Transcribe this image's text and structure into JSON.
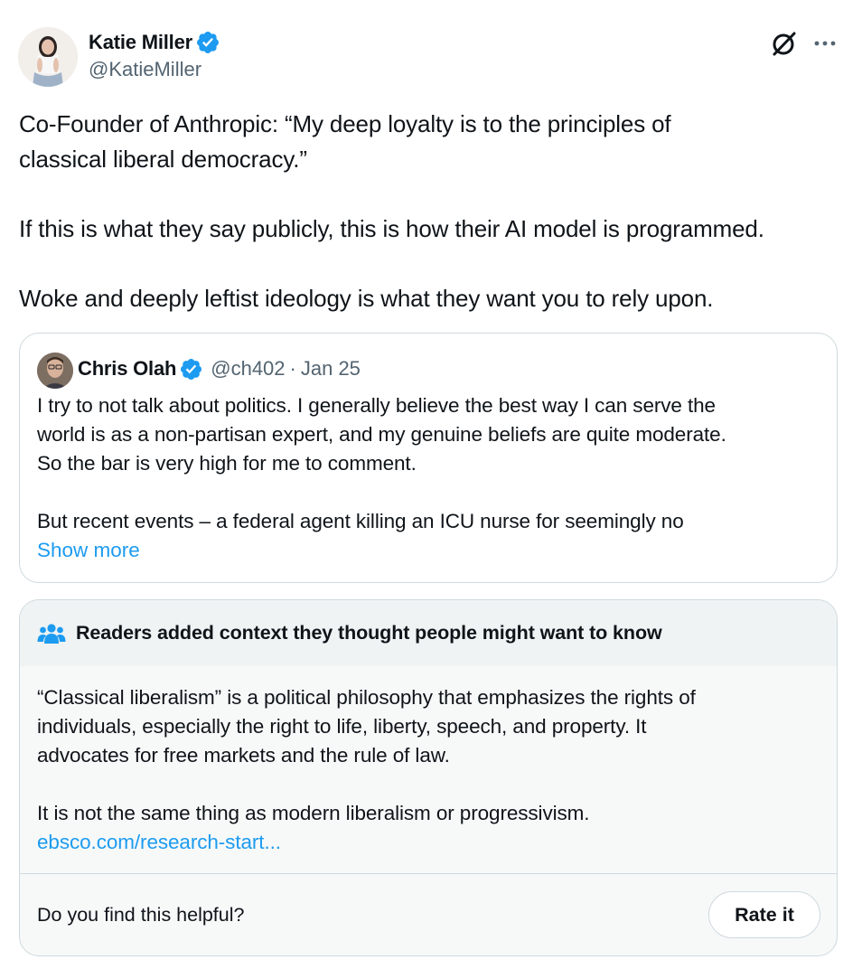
{
  "post": {
    "author_name": "Katie Miller",
    "author_handle": "@KatieMiller",
    "verified": true,
    "text": [
      "Co-Founder of Anthropic: “My deep loyalty is to the principles of",
      "classical liberal democracy.”",
      "",
      "If this is what they say publicly, this is how their AI model is programmed.",
      "",
      "Woke and deeply leftist ideology is what they want you to rely upon."
    ]
  },
  "quote": {
    "author_name": "Chris Olah",
    "author_handle": "@ch402",
    "separator": "·",
    "date": "Jan 25",
    "verified": true,
    "text": [
      "I try to not talk about politics. I generally believe the best way I can serve the",
      "world is as a non-partisan expert, and my genuine beliefs are quite moderate.",
      "So the bar is very high for me to comment.",
      "",
      "But recent events – a federal agent killing an ICU nurse for seemingly no"
    ],
    "show_more_label": "Show more"
  },
  "community_note": {
    "title": "Readers added context they thought people might want to know",
    "body": [
      "“Classical liberalism” is a political philosophy that emphasizes the rights of",
      "individuals, especially the right to life, liberty, speech, and property. It",
      "advocates for free markets and the rule of law.",
      "",
      "It is not the same thing as modern liberalism or progressivism."
    ],
    "link_text": "ebsco.com/research-start...",
    "footer_question": "Do you find this helpful?",
    "rate_label": "Rate it"
  },
  "icons": {
    "verified": "verified-badge-icon",
    "grok": "grok-icon",
    "more": "more-options-icon",
    "people": "people-icon"
  },
  "colors": {
    "accent": "#1d9bf0",
    "text_primary": "#0f1419",
    "text_secondary": "#536471",
    "border": "#cfd9de",
    "note_header_bg": "#eff3f4",
    "note_bg": "#f7f9f9"
  }
}
